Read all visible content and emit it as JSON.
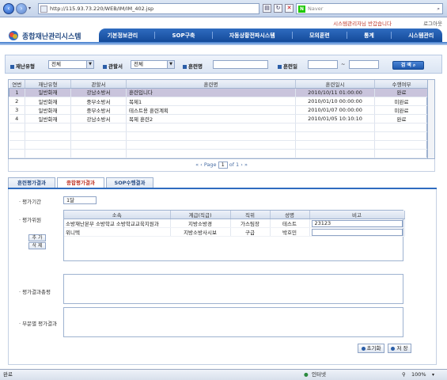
{
  "browser": {
    "address": "http://115.93.73.220/WEB/IM/IM_402.jsp",
    "search_placeholder": "Naver",
    "status_left": "완료",
    "status_zone": "인터넷",
    "zoom": "100%"
  },
  "header": {
    "welcome": "시스템관리자님 반갑습니다",
    "logout": "로그아웃",
    "logo_text": "종합재난관리시스템",
    "menu": [
      "기본정보관리",
      "SOP구축",
      "자동상황전파시스템",
      "모의훈련",
      "통계",
      "시스템관리"
    ]
  },
  "search": {
    "disaster_type_label": "재난유형",
    "disaster_type_value": "전체",
    "agency_label": "관할서",
    "agency_value": "전체",
    "training_name_label": "훈련명",
    "training_date_label": "훈련일",
    "range_sep": "~",
    "search_button": "검 색"
  },
  "grid": {
    "columns": [
      "연번",
      "재난유형",
      "관할서",
      "훈련명",
      "훈련일시",
      "수행여부"
    ],
    "rows": [
      [
        "1",
        "일반화재",
        "강남소방서",
        "훈련입니다",
        "2010/10/11 01:00:00",
        "완료"
      ],
      [
        "2",
        "일반화재",
        "중부소방서",
        "복제1",
        "2010/01/10 00:00:00",
        "미완료"
      ],
      [
        "3",
        "일반화재",
        "중부소방서",
        "테스트용 훈련계획",
        "2010/01/07 00:00:00",
        "미완료"
      ],
      [
        "4",
        "일반화재",
        "강남소방서",
        "복제 훈련2",
        "2010/01/05 10:10:10",
        "완료"
      ]
    ],
    "selected_row": 0
  },
  "pager": {
    "first": "«",
    "prev": "‹",
    "page_label": "Page",
    "page": "1",
    "of": "of 1",
    "next": "›",
    "last": "»"
  },
  "tabs": [
    "훈련평가결과",
    "종합평가결과",
    "SOP수행결과"
  ],
  "active_tab": 1,
  "panel": {
    "period_label": "평가기간",
    "period_value": "1달",
    "evaluator_label": "평가위원",
    "eval_columns": [
      "소속",
      "계급(직급)",
      "직위",
      "성명",
      "비고"
    ],
    "eval_rows": [
      [
        "소방재난본부 소방학교 소방학교교육지원과",
        "지방소방경",
        "가스팀장",
        "테스트",
        "23123"
      ],
      [
        "위니텍",
        "지방소방사시보",
        "구급",
        "박호민",
        ""
      ]
    ],
    "add_button": "추 가",
    "delete_button": "삭 제",
    "summary_label": "평가결과총평",
    "dept_label": "부문별 평가결과",
    "reset_button": "초기화",
    "save_button": "저 장"
  }
}
